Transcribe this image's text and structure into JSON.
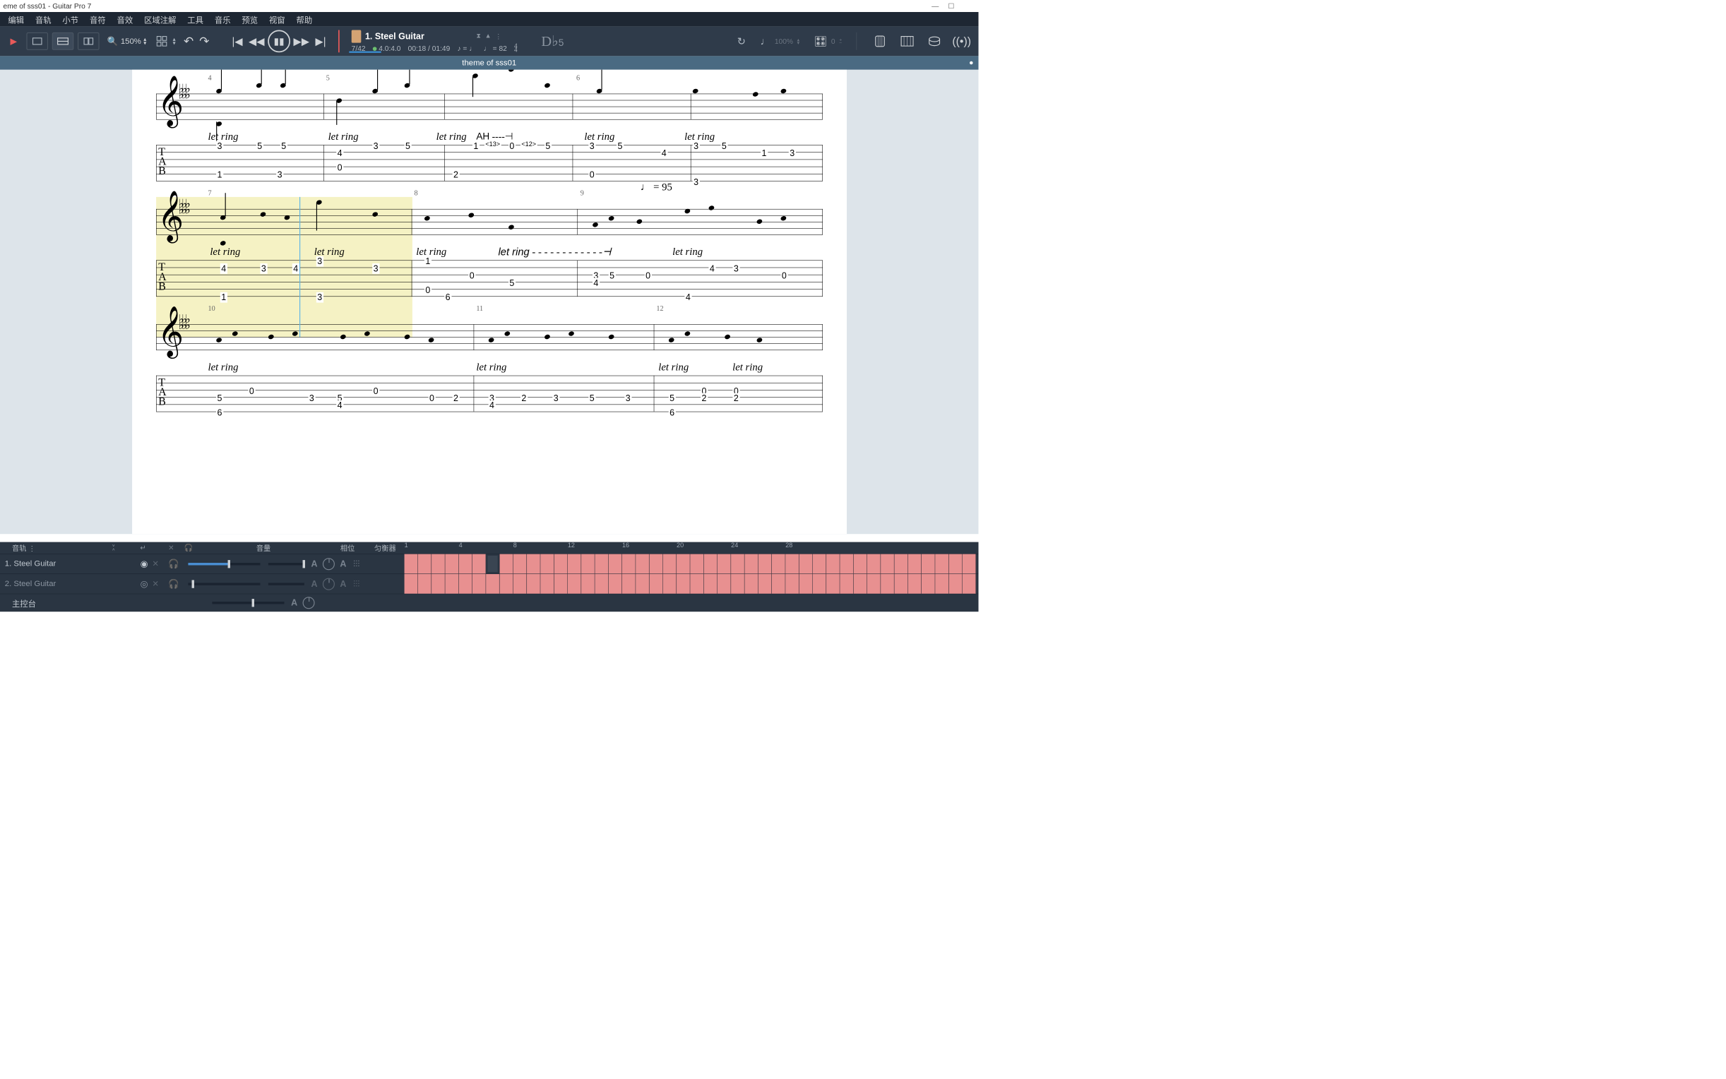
{
  "title": "eme of sss01 - Guitar Pro 7",
  "menu": [
    "编辑",
    "音轨",
    "小节",
    "音符",
    "音效",
    "区域注解",
    "工具",
    "音乐",
    "预览",
    "视窗",
    "帮助"
  ],
  "toolbar": {
    "zoom": "150%",
    "track": {
      "number": "1.",
      "name": "Steel Guitar"
    },
    "bar_pos": "7/42",
    "time_sig": "4.0:4.0",
    "time_current": "00:18",
    "time_total": "01:49",
    "tempo_prefix": "♪ = ♩",
    "tempo_bpm": "♩ = 82",
    "ts_display": "4\n4",
    "key": "D♭5",
    "loop_pct": "100%",
    "tune_val": "0"
  },
  "song_title": "theme of sss01",
  "score": {
    "tempo_change": "♩ = 95",
    "ah": "AH",
    "let_ring": "let ring",
    "bars": [
      4,
      5,
      6,
      7,
      8,
      9,
      10,
      11,
      12
    ],
    "sys1": {
      "frets": [
        {
          "bar": 4,
          "vals": [
            [
              "3",
              "5",
              "5"
            ],
            [
              ""
            ],
            [
              ""
            ],
            [
              "1"
            ],
            [
              ""
            ],
            [
              ""
            ]
          ],
          "x": [
            170,
            260,
            310
          ]
        },
        {
          "bar": 5,
          "seq": [
            "3",
            "5",
            "4",
            "0",
            "3"
          ],
          "x": [
            540,
            620,
            450,
            450,
            540
          ],
          "str": [
            1,
            1,
            2,
            3,
            4
          ]
        },
        {
          "bar": 6,
          "seq": [
            "1",
            "<13>",
            "0",
            "<12>",
            "5",
            "2"
          ],
          "x": [
            790,
            830,
            880,
            920,
            970,
            810
          ],
          "str": [
            1,
            1,
            1,
            1,
            1,
            4
          ]
        },
        {
          "bar": 7,
          "seq": [
            "3",
            "5",
            "4",
            "0"
          ],
          "x": [
            1100,
            1170,
            1150,
            1100
          ],
          "str": [
            1,
            1,
            2,
            4
          ]
        },
        {
          "bar": 7,
          "seq2": [
            "3",
            "5",
            "1",
            "3",
            "3"
          ],
          "x": [
            1340,
            1410,
            1490,
            1560,
            1330
          ],
          "str": [
            1,
            1,
            1,
            1,
            5
          ]
        }
      ]
    }
  },
  "bottom": {
    "header": {
      "tracks": "音轨",
      "vol": "音量",
      "pan": "相位",
      "eq": "匀衡器"
    },
    "ruler": [
      "1",
      "4",
      "8",
      "12",
      "16",
      "20",
      "24",
      "28"
    ],
    "tracks": [
      {
        "n": "1.",
        "name": "Steel Guitar",
        "visible": true,
        "vol": 55,
        "active": true
      },
      {
        "n": "2.",
        "name": "Steel Guitar",
        "visible": true,
        "vol": 5,
        "active": false
      }
    ],
    "master": "主控台",
    "total_bars": 42,
    "current_bar": 7
  }
}
